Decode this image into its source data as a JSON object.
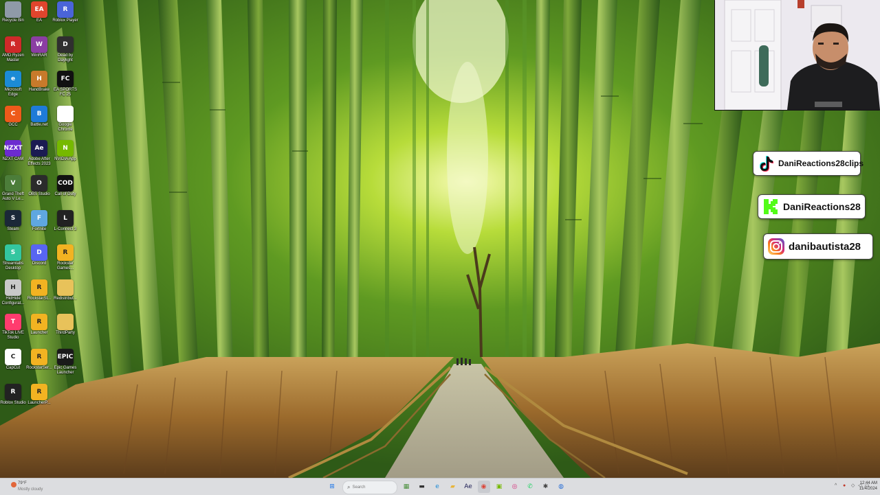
{
  "desktop": {
    "icons": [
      {
        "label": "Recycle Bin",
        "glyph": "",
        "color": "#8f9aa8"
      },
      {
        "label": "EA",
        "glyph": "EA",
        "color": "#e0452d"
      },
      {
        "label": "Roblox Player",
        "glyph": "R",
        "color": "#4a64d8"
      },
      {
        "label": "AMD Ryzen Master",
        "glyph": "R",
        "color": "#cf2929"
      },
      {
        "label": "WinRAR",
        "glyph": "W",
        "color": "#8b3ea3"
      },
      {
        "label": "Dead by Daylight",
        "glyph": "D",
        "color": "#2f2f2f"
      },
      {
        "label": "Microsoft Edge",
        "glyph": "e",
        "color": "#1c8bd6"
      },
      {
        "label": "HandBrake",
        "glyph": "H",
        "color": "#c87a2b"
      },
      {
        "label": "EA SPORTS FC 25",
        "glyph": "FC",
        "color": "#111111"
      },
      {
        "label": "GCC",
        "glyph": "C",
        "color": "#ee5a1a"
      },
      {
        "label": "Battle.net",
        "glyph": "B",
        "color": "#1e7bd8"
      },
      {
        "label": "Google Chrome",
        "glyph": "",
        "color": "#ffffff"
      },
      {
        "label": "NZXT CAM",
        "glyph": "NZXT",
        "color": "#6c2bd0"
      },
      {
        "label": "Adobe After Effects 2023",
        "glyph": "Ae",
        "color": "#1b1b52"
      },
      {
        "label": "NVIDIA App",
        "glyph": "N",
        "color": "#76b900"
      },
      {
        "label": "Grand Theft Auto V Le...",
        "glyph": "V",
        "color": "#4c7d3a"
      },
      {
        "label": "OBS Studio",
        "glyph": "O",
        "color": "#2b2b2b"
      },
      {
        "label": "Call of Duty",
        "glyph": "COD",
        "color": "#111111"
      },
      {
        "label": "Steam",
        "glyph": "S",
        "color": "#1b2838"
      },
      {
        "label": "Fortnite",
        "glyph": "F",
        "color": "#5fa7e0"
      },
      {
        "label": "L-Connect 3",
        "glyph": "L",
        "color": "#222222"
      },
      {
        "label": "Streamlabs Desktop",
        "glyph": "S",
        "color": "#33c6a0"
      },
      {
        "label": "Discord",
        "glyph": "D",
        "color": "#5865f2"
      },
      {
        "label": "Rockstar Games...",
        "glyph": "R",
        "color": "#f2b322"
      },
      {
        "label": "HidHide Configurat...",
        "glyph": "H",
        "color": "#c9c9c9"
      },
      {
        "label": "RockstarSt...",
        "glyph": "R",
        "color": "#f2b322"
      },
      {
        "label": "Redistribut...",
        "glyph": "",
        "color": "#e8c25a"
      },
      {
        "label": "TikTok LIVE Studio",
        "glyph": "T",
        "color": "#ff3c6e"
      },
      {
        "label": "Launcher",
        "glyph": "R",
        "color": "#f2b322"
      },
      {
        "label": "ThirdParty",
        "glyph": "",
        "color": "#e8c25a"
      },
      {
        "label": "CapCut",
        "glyph": "C",
        "color": "#ffffff"
      },
      {
        "label": "RockstarSer...",
        "glyph": "R",
        "color": "#f2b322"
      },
      {
        "label": "Epic Games Launcher",
        "glyph": "EPIC",
        "color": "#1a1a1a"
      },
      {
        "label": "Roblox Studio",
        "glyph": "R",
        "color": "#222222"
      },
      {
        "label": "LauncherP...",
        "glyph": "R",
        "color": "#f2b322"
      }
    ]
  },
  "social": {
    "tiktok": {
      "handle": "DaniReactions28clips"
    },
    "kick": {
      "handle": "DaniReactions28",
      "color": "#53fc18"
    },
    "instagram": {
      "handle": "danibautista28"
    }
  },
  "taskbar": {
    "weather": {
      "temp": "79°F",
      "condition": "Mostly cloudy"
    },
    "search_placeholder": "Search",
    "apps": [
      {
        "name": "start-button",
        "glyph": "⊞",
        "color": "#1a73e8"
      },
      {
        "name": "widgets",
        "glyph": "▦",
        "color": "#4a8f3c"
      },
      {
        "name": "file-explorer",
        "glyph": "▬",
        "color": "#333333"
      },
      {
        "name": "edge",
        "glyph": "e",
        "color": "#1c8bd6"
      },
      {
        "name": "folder",
        "glyph": "▰",
        "color": "#e8b53a"
      },
      {
        "name": "after-effects",
        "glyph": "Ae",
        "color": "#1b1b52"
      },
      {
        "name": "chrome",
        "glyph": "◉",
        "color": "#db4437"
      },
      {
        "name": "nvidia",
        "glyph": "▣",
        "color": "#76b900"
      },
      {
        "name": "instagram",
        "glyph": "◎",
        "color": "#d62976"
      },
      {
        "name": "whatsapp",
        "glyph": "✆",
        "color": "#25d366"
      },
      {
        "name": "settings",
        "glyph": "✱",
        "color": "#444444"
      },
      {
        "name": "app-extra",
        "glyph": "◍",
        "color": "#2a6fd6"
      }
    ],
    "clock": {
      "time": "12:44 AM",
      "date": "11/4/2024"
    }
  }
}
